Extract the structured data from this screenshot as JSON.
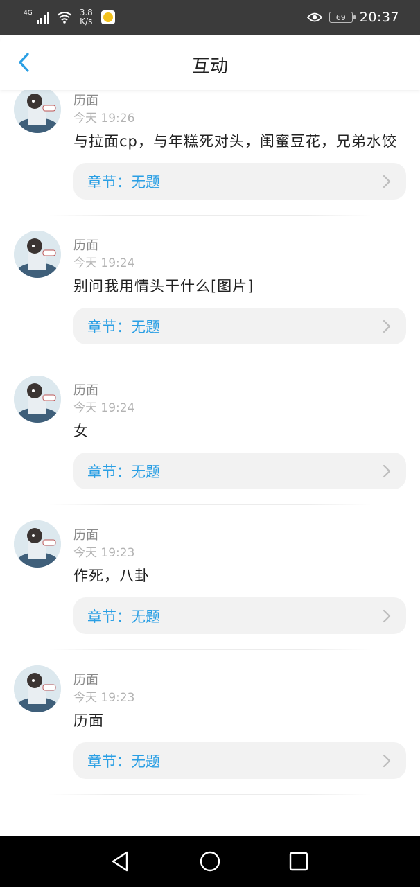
{
  "status_bar": {
    "network": "4G",
    "speed_value": "3.8",
    "speed_unit": "K/s",
    "battery": "69",
    "time": "20:37",
    "icons": [
      "signal-icon",
      "wifi-icon",
      "app-notification-icon",
      "eye-icon",
      "battery-icon"
    ]
  },
  "header": {
    "title": "互动",
    "back_icon": "chevron-left-icon"
  },
  "colors": {
    "accent": "#2a9fe4",
    "status_bar_bg": "#3b3b3b",
    "chapter_bg": "#f2f2f2"
  },
  "comments": [
    {
      "name": "历面",
      "time": "今天 19:26",
      "content": "与拉面cp，与年糕死对头，闺蜜豆花，兄弟水饺",
      "chapter": "章节：无题"
    },
    {
      "name": "历面",
      "time": "今天 19:24",
      "content": "别问我用情头干什么[图片]",
      "chapter": "章节：无题"
    },
    {
      "name": "历面",
      "time": "今天 19:24",
      "content": "女",
      "chapter": "章节：无题"
    },
    {
      "name": "历面",
      "time": "今天 19:23",
      "content": "作死，八卦",
      "chapter": "章节：无题"
    },
    {
      "name": "历面",
      "time": "今天 19:23",
      "content": "历面",
      "chapter": "章节：无题"
    }
  ],
  "nav_bar": {
    "icons": [
      "back-triangle-icon",
      "home-circle-icon",
      "recents-square-icon"
    ]
  }
}
